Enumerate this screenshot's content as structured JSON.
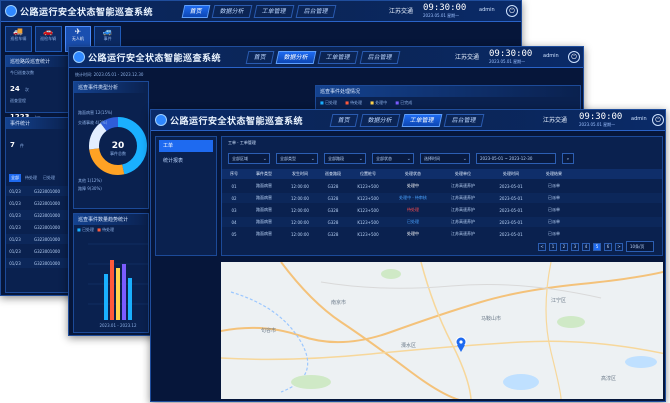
{
  "app": {
    "title": "公路运行安全状态智能巡查系统",
    "brand": "江苏交通",
    "clock": "09:30:00",
    "date": "2023.05.01 星期一",
    "user": "admin"
  },
  "nav": {
    "w1": [
      "首页",
      "数据分析",
      "工单管理",
      "后台管理"
    ],
    "w2": [
      "首页",
      "数据分析",
      "工单管理",
      "后台管理"
    ],
    "w3": [
      "首页",
      "数据分析",
      "工单管理",
      "后台管理"
    ]
  },
  "win1": {
    "tools": [
      {
        "label": "巡检车辆",
        "icon": "truck-icon"
      },
      {
        "label": "巡检车辆",
        "icon": "car-icon"
      },
      {
        "label": "无人机",
        "icon": "drone-icon"
      },
      {
        "label": "事件",
        "icon": "car-icon"
      }
    ],
    "stats_title": "巡检路段巡查统计",
    "stat1_label": "今日巡查次数",
    "stat1_value": "24",
    "stat1_unit": "次",
    "stat2_label": "巡查里程",
    "stat2_value": "1223",
    "stat2_unit": "km",
    "events_title": "事件统计",
    "ev_value": "7",
    "ev_unit": "件",
    "tabs": [
      "全部",
      "待处理",
      "已处理"
    ],
    "rows": [
      [
        "01/23",
        "G323001000"
      ],
      [
        "01/23",
        "G323001000"
      ],
      [
        "01/23",
        "G323001000"
      ],
      [
        "01/23",
        "G323001000"
      ],
      [
        "01/23",
        "G323001000"
      ],
      [
        "01/23",
        "G323001000"
      ],
      [
        "01/23",
        "G323001000"
      ]
    ]
  },
  "win2": {
    "date_label": "统计时间: 2023.05.01 - 2023.12.30",
    "donut_title": "巡查事件类型分析",
    "donut_center": "20",
    "donut_sub": "事件总数",
    "donut_labels": [
      "路面病害 12(15%)",
      "交通事故 4(2%)",
      "其他 1(12%)",
      "路障 9(30%)"
    ],
    "bar_title": "巡查事件数量趋势统计",
    "legend": [
      "已处理",
      "待处理",
      "已完成"
    ],
    "colors": {
      "c1": "#1ab0ff",
      "c2": "#ff5a3c",
      "c3": "#ffd44d"
    },
    "bar_caption": "2023.01 - 2023.12",
    "right_title": "巡查事件处理情况",
    "right_legend": [
      "已处理",
      "待处理",
      "处理中",
      "已完成"
    ]
  },
  "win3": {
    "side": [
      "工单",
      "统计报表"
    ],
    "crumb": "工单 · 工单管理",
    "filters": [
      "全部区域",
      "全部类型",
      "全部路段",
      "全部状态",
      "选择时间",
      "2023-05-01 ~ 2023-12-30"
    ],
    "search_icon": "search-icon",
    "headers": [
      "序号",
      "事件类型",
      "发生时间",
      "巡查路段",
      "位置桩号",
      "处理状态",
      "处理单位",
      "处理时间",
      "处理结果"
    ],
    "rows": [
      [
        "01",
        "路面病害",
        "12:00:00",
        "G328",
        "K123+500",
        "处理中",
        "江苏高速养护",
        "2023-05-01",
        "已派单"
      ],
      [
        "02",
        "路面病害",
        "12:00:00",
        "G328",
        "K123+500",
        "处理中 · 待审核",
        "江苏高速养护",
        "2023-05-01",
        "已派单"
      ],
      [
        "03",
        "路面病害",
        "12:00:00",
        "G328",
        "K123+500",
        "待处理",
        "江苏高速养护",
        "2023-05-01",
        "已派单"
      ],
      [
        "04",
        "路面病害",
        "12:00:00",
        "G328",
        "K123+500",
        "已处理",
        "江苏高速养护",
        "2023-05-01",
        "已派单"
      ],
      [
        "05",
        "路面病害",
        "12:00:00",
        "G328",
        "K123+500",
        "处理中",
        "江苏高速养护",
        "2023-05-01",
        "已派单"
      ]
    ],
    "status_colors": [
      "#ffffff",
      "#4aa3ff",
      "#ff4d4f",
      "#4aa3ff",
      "#ffffff"
    ],
    "pages": [
      "<",
      "1",
      "2",
      "3",
      "4",
      "5",
      "6",
      ">"
    ],
    "page_size": "10条/页",
    "map_places": [
      "南京市",
      "马鞍山市",
      "溧水区",
      "句容市",
      "江宁区",
      "高淳区"
    ]
  }
}
